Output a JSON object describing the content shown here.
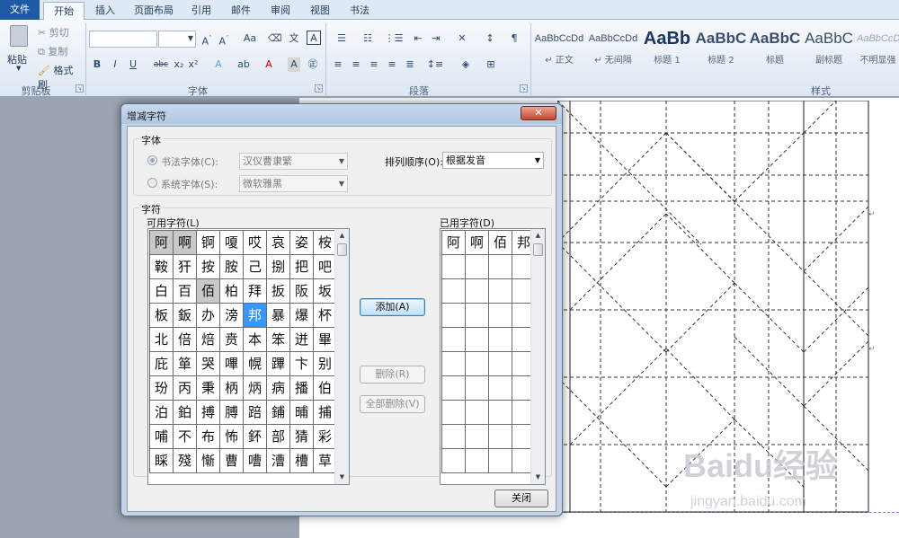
{
  "ribbon": {
    "tabs": [
      {
        "label": "文件"
      },
      {
        "label": "开始"
      },
      {
        "label": "插入"
      },
      {
        "label": "页面布局"
      },
      {
        "label": "引用"
      },
      {
        "label": "邮件"
      },
      {
        "label": "审阅"
      },
      {
        "label": "视图"
      },
      {
        "label": "书法"
      }
    ],
    "clipboard": {
      "paste_label": "粘贴",
      "cut_label": "剪切",
      "copy_label": "复制",
      "format_painter_label": "格式刷",
      "group_label": "剪贴板"
    },
    "font": {
      "group_label": "字体",
      "name_value": "",
      "size_value": ""
    },
    "paragraph": {
      "group_label": "段落"
    },
    "styles": {
      "group_label": "样式",
      "items": [
        {
          "sample": "AaBbCcDd",
          "name": "↵ 正文"
        },
        {
          "sample": "AaBbCcDd",
          "name": "↵ 无间隔"
        },
        {
          "sample": "AaBb",
          "name": "标题 1"
        },
        {
          "sample": "AaBbC",
          "name": "标题 2"
        },
        {
          "sample": "AaBbC",
          "name": "标题"
        },
        {
          "sample": "AaBbC",
          "name": "副标题"
        },
        {
          "sample": "AaBbCcDd",
          "name": "不明显强"
        }
      ]
    }
  },
  "dialog": {
    "title": "增减字符",
    "close_glyph": "✕",
    "font_section": {
      "legend": "字体",
      "calligraphy_font_label": "书法字体(C):",
      "calligraphy_font_value": "汉仪曹隶繁",
      "system_font_label": "系统字体(S):",
      "system_font_value": "微软雅黑",
      "sort_order_label": "排列顺序(O):",
      "sort_order_value": "根据发音"
    },
    "char_section": {
      "legend": "字符",
      "available_label": "可用字符(L)",
      "used_label": "已用字符(D)",
      "available_rows": [
        [
          "阿",
          "啊",
          "锕",
          "嗄",
          "哎",
          "哀",
          "姿",
          "桉"
        ],
        [
          "鞍",
          "犴",
          "按",
          "胺",
          "己",
          "捌",
          "把",
          "吧"
        ],
        [
          "白",
          "百",
          "佰",
          "柏",
          "拜",
          "扳",
          "阪",
          "坂"
        ],
        [
          "板",
          "鈑",
          "办",
          "滂",
          "邦",
          "暴",
          "爆",
          "杯"
        ],
        [
          "北",
          "倍",
          "焙",
          "贲",
          "本",
          "笨",
          "迸",
          "畢"
        ],
        [
          "庇",
          "箪",
          "哭",
          "嗶",
          "幌",
          "蹕",
          "卞",
          "别"
        ],
        [
          "玢",
          "丙",
          "秉",
          "柄",
          "炳",
          "病",
          "播",
          "伯"
        ],
        [
          "泊",
          "鉑",
          "搏",
          "膊",
          "踣",
          "鋪",
          "晡",
          "捕"
        ],
        [
          "哺",
          "不",
          "布",
          "怖",
          "鈈",
          "部",
          "猜",
          "彩"
        ],
        [
          "睬",
          "殘",
          "慚",
          "曹",
          "嘈",
          "漕",
          "槽",
          "草"
        ]
      ],
      "selected_char": "邦",
      "used_chars": [
        "阿",
        "啊",
        "佰",
        "邦"
      ]
    },
    "buttons": {
      "add": "添加(A)",
      "delete": "删除(R)",
      "delete_all": "全部删除(V)",
      "close": "关闭"
    }
  },
  "watermark": {
    "brand": "Baidu经验",
    "url": "jingyan.baidu.com"
  },
  "paragraph_mark": "↵",
  "colors": {
    "file_tab": "#1f5aa6",
    "selection": "#3399ff",
    "dialog_frame": "#c4d4e6"
  }
}
